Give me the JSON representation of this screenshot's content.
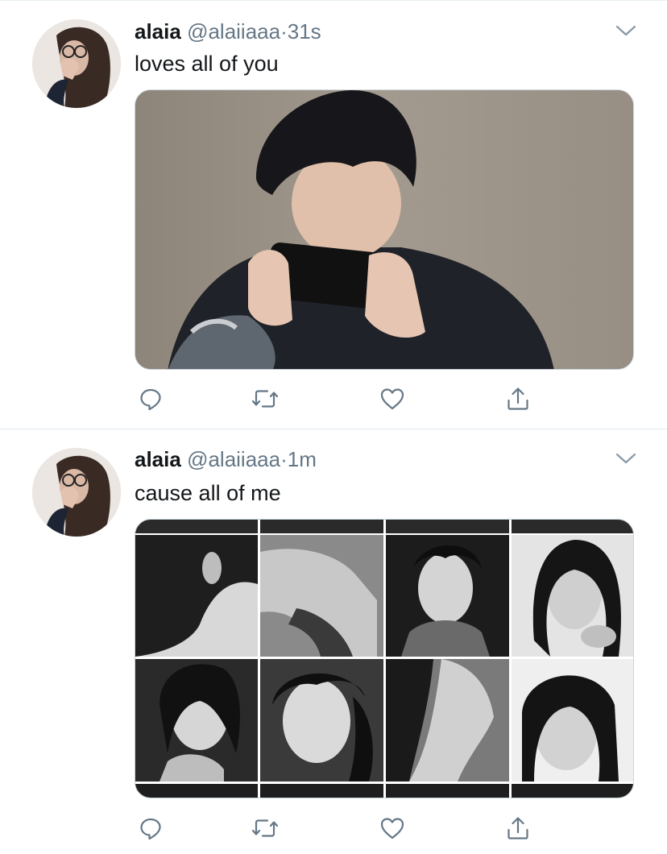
{
  "tweets": [
    {
      "display_name": "alaia",
      "handle": "@alaiiaaa",
      "separator": "·",
      "time": "31s",
      "text": "loves all of you",
      "media_type": "photo",
      "avatar_icon": "profile-photo"
    },
    {
      "display_name": "alaia",
      "handle": "@alaiiaaa",
      "separator": "·",
      "time": "1m",
      "text": "cause all of me",
      "media_type": "photo-collage",
      "avatar_icon": "profile-photo"
    }
  ],
  "actions": {
    "reply_icon": "reply-icon",
    "retweet_icon": "retweet-icon",
    "like_icon": "heart-icon",
    "share_icon": "share-icon"
  },
  "colors": {
    "text_primary": "#14171a",
    "text_secondary": "#657786",
    "divider": "#e1e8ed",
    "icon": "#657786"
  }
}
